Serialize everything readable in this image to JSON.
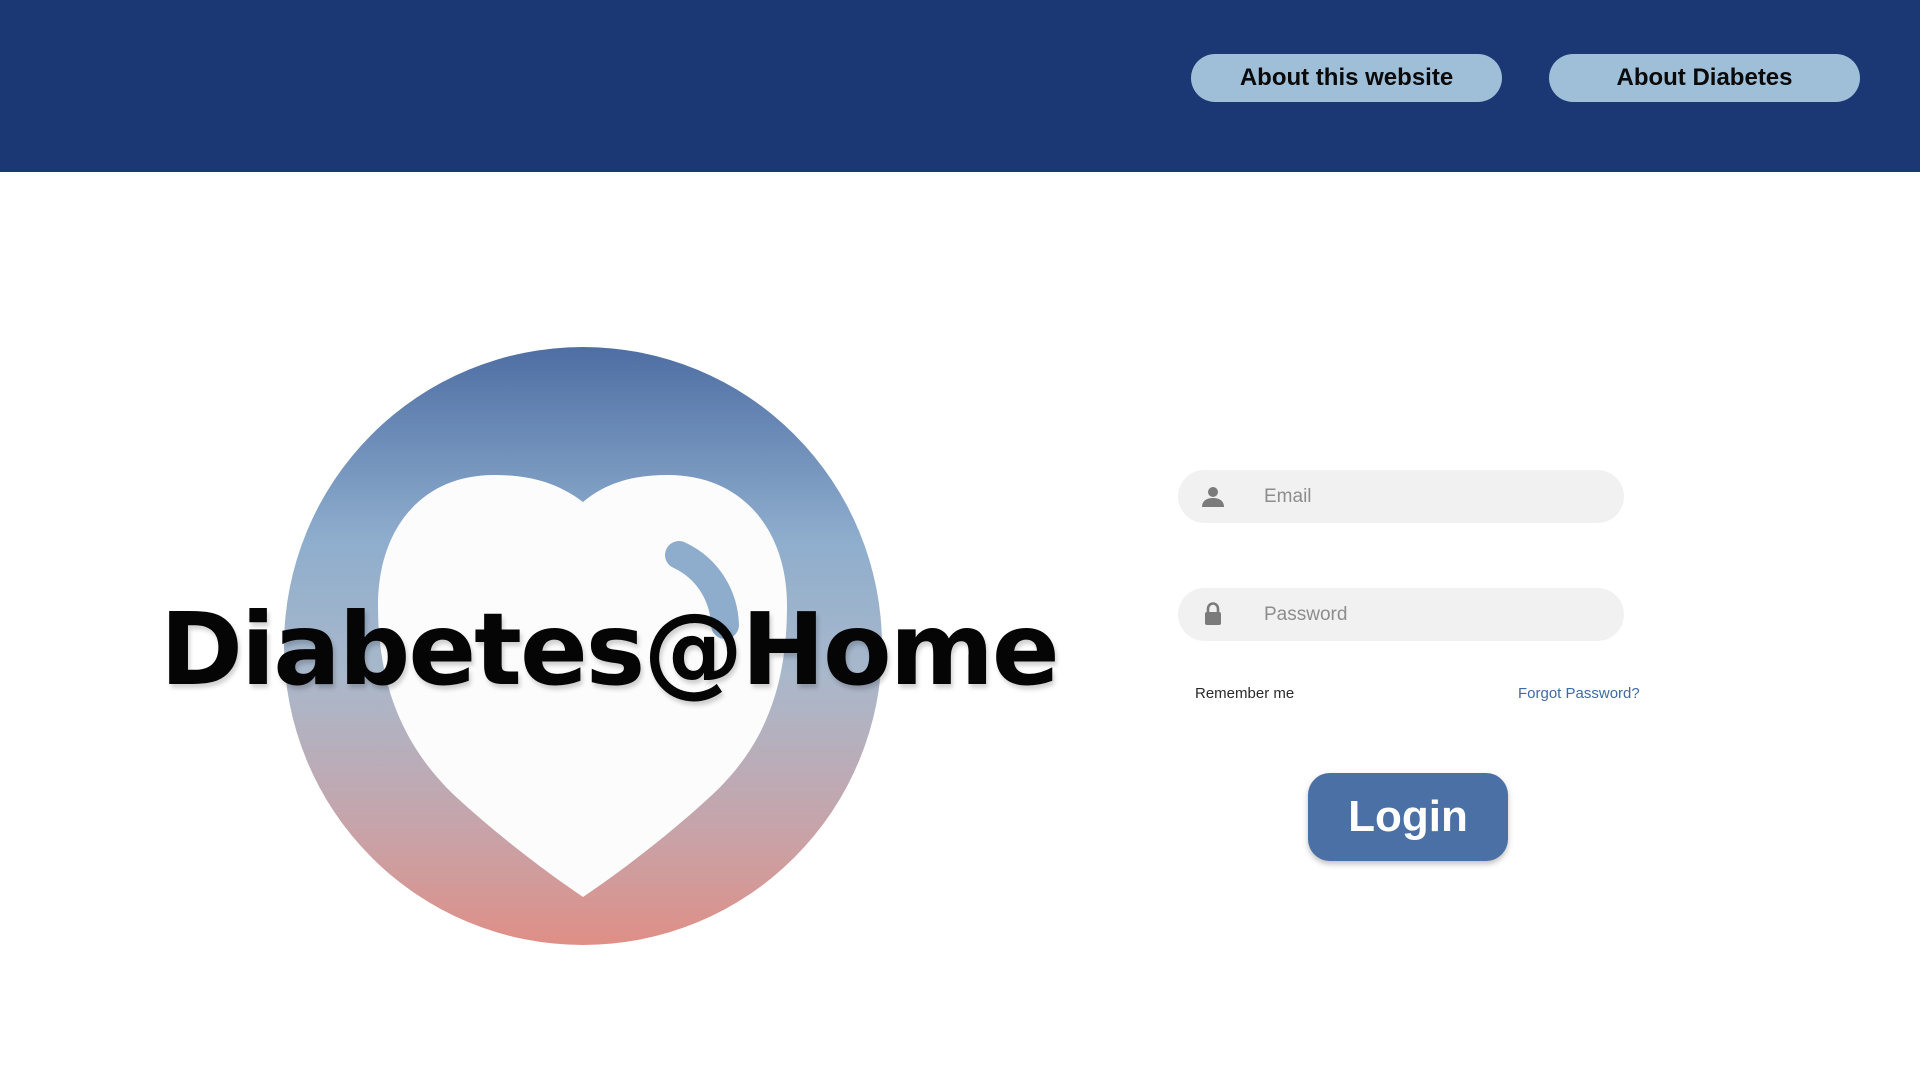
{
  "header": {
    "background_color": "#1b3774",
    "nav": [
      {
        "label": "About this website"
      },
      {
        "label": "About Diabetes"
      }
    ]
  },
  "brand": {
    "title": "Diabetes@Home",
    "logo_icon": "heart-icon"
  },
  "login_form": {
    "email": {
      "placeholder": "Email",
      "value": "",
      "icon": "user-icon"
    },
    "password": {
      "placeholder": "Password",
      "value": "",
      "icon": "lock-icon"
    },
    "remember_label": "Remember me",
    "forgot_label": "Forgot Password?",
    "submit_label": "Login"
  },
  "colors": {
    "nav_button": "#9fbed8",
    "login_button": "#4a70a6",
    "link": "#3f6ba4",
    "field_background": "#f1f1f1"
  }
}
